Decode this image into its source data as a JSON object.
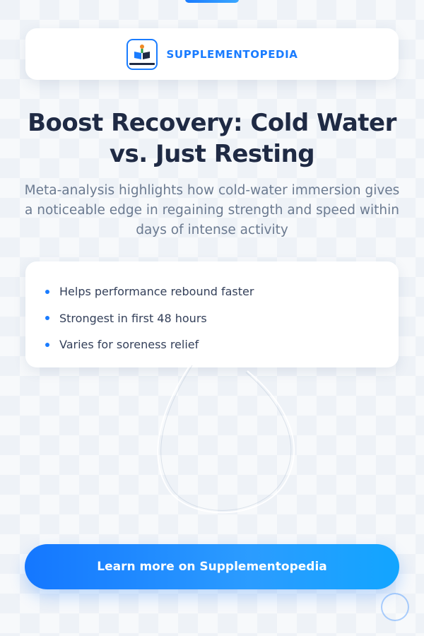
{
  "brand": {
    "name": "SUPPLEMENTOPEDIA",
    "logo_icon": "book-icon",
    "accent_color": "#1a7cff"
  },
  "headline": "Boost Recovery: Cold Water vs. Just Resting",
  "subhead": "Meta-analysis highlights how cold-water immersion gives a noticeable edge in regaining strength and speed within days of intense activity",
  "bullets": [
    "Helps performance rebound faster",
    "Strongest in first 48 hours",
    "Varies for soreness relief"
  ],
  "cta": {
    "label": "Learn more on Supplementopedia"
  },
  "colors": {
    "headline": "#1f2a44",
    "subhead": "#6b7a90",
    "bullet_text": "#34405a",
    "cta_start": "#1477ff",
    "cta_end": "#12a5ff"
  }
}
